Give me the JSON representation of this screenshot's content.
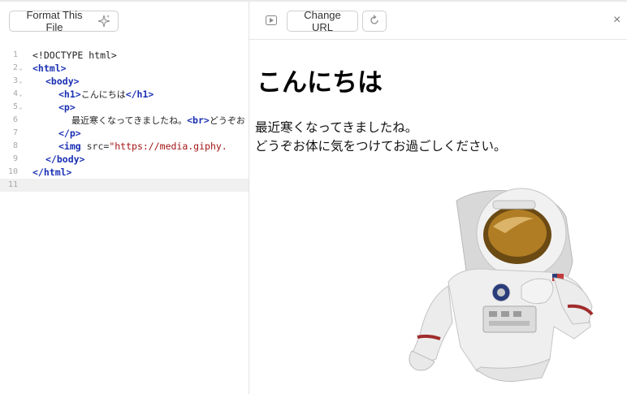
{
  "editor": {
    "format_button_label": "Format This File",
    "lines": [
      {
        "num": "1",
        "fold": false,
        "code": [
          "<!DOCTYPE html>"
        ]
      },
      {
        "num": "2",
        "fold": true,
        "code": [
          "<html>"
        ]
      },
      {
        "num": "3",
        "fold": true,
        "code": [
          "<body>"
        ]
      },
      {
        "num": "4",
        "fold": true,
        "code": [
          "<h1>",
          "こんにちは",
          "</h1>"
        ]
      },
      {
        "num": "5",
        "fold": true,
        "code": [
          "<p>"
        ]
      },
      {
        "num": "6",
        "fold": false,
        "code": [
          "最近寒くなってきましたね。",
          "<br>",
          "どうぞお"
        ]
      },
      {
        "num": "7",
        "fold": false,
        "code": [
          "</p>"
        ]
      },
      {
        "num": "8",
        "fold": false,
        "code": [
          "<img",
          " src=",
          "\"https://media.giphy."
        ]
      },
      {
        "num": "9",
        "fold": false,
        "code": [
          "</body>"
        ]
      },
      {
        "num": "10",
        "fold": false,
        "code": [
          "</html>"
        ]
      },
      {
        "num": "11",
        "fold": false,
        "code": [
          ""
        ]
      }
    ]
  },
  "preview": {
    "change_url_label": "Change URL",
    "heading": "こんにちは",
    "paragraph_line1": "最近寒くなってきましたね。",
    "paragraph_line2": "どうぞお体に気をつけてお過ごしください。"
  },
  "icons": {
    "sparkle": "sparkle-icon",
    "play": "play-icon",
    "refresh": "refresh-icon",
    "close": "close-icon"
  },
  "colors": {
    "tag": "#1a2fb3",
    "string": "#a31515",
    "gutter": "#a8a8a8"
  }
}
